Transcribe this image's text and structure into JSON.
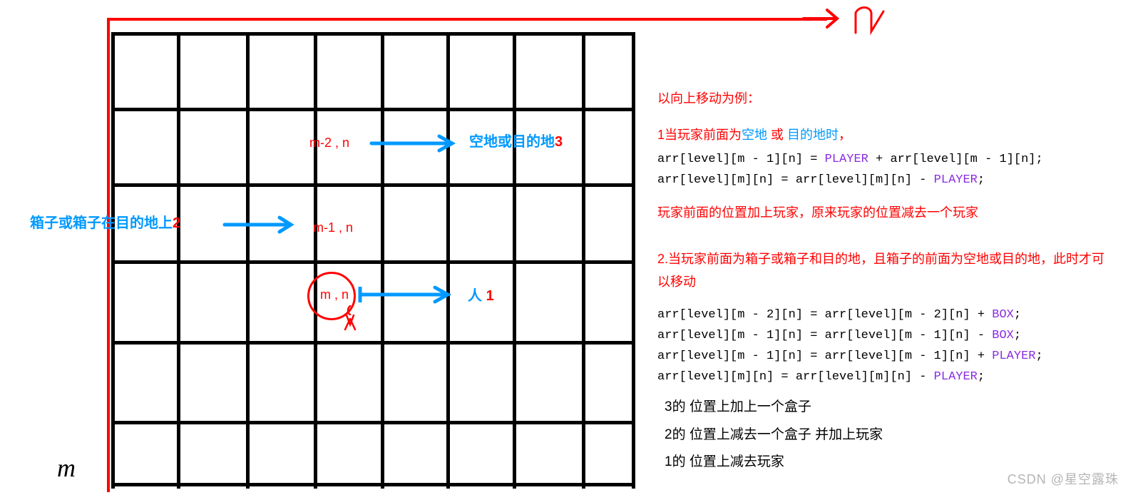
{
  "axes": {
    "top_label": "n",
    "left_label": "m"
  },
  "grid_cells": {
    "cell_m2n": "m-2 , n",
    "cell_m1n": "m-1 , n",
    "cell_mn": "m , n"
  },
  "grid_right_labels": {
    "label3_prefix": "空地或目的地",
    "label3_suffix": "3",
    "label2_prefix": "箱子或箱子在目的地上",
    "label2_suffix": "2",
    "label1_prefix": "人",
    "label1_suffix": "1"
  },
  "panel": {
    "heading": "以向上移动为例：",
    "case1_prefix": "1当玩家前面为",
    "case1_blue1": "空地",
    "case1_mid": " 或 ",
    "case1_blue2": "目的地时",
    "case1_end": "，",
    "code1_a_pre": "arr[level][m - 1][n] = ",
    "code1_a_kw": "PLAYER",
    "code1_a_post": " + arr[level][m - 1][n];",
    "code1_b_pre": "arr[level][m][n] = arr[level][m][n] - ",
    "code1_b_kw": "PLAYER",
    "code1_b_post": ";",
    "case1_expl": "玩家前面的位置加上玩家，原来玩家的位置减去一个玩家",
    "case2": "2.当玩家前面为箱子或箱子和目的地，且箱子的前面为空地或目的地，此时才可以移动",
    "code2_a_pre": "arr[level][m - 2][n] = arr[level][m - 2][n] + ",
    "code2_a_kw": "BOX",
    "code2_a_post": ";",
    "code2_b_pre": "arr[level][m - 1][n] = arr[level][m - 1][n] - ",
    "code2_b_kw": "BOX",
    "code2_b_post": ";",
    "code2_c_pre": "arr[level][m - 1][n] = arr[level][m - 1][n] + ",
    "code2_c_kw": "PLAYER",
    "code2_c_post": ";",
    "code2_d_pre": "arr[level][m][n] = arr[level][m][n] - ",
    "code2_d_kw": "PLAYER",
    "code2_d_post": ";",
    "note3": "3的 位置上加上一个盒子",
    "note2": "2的 位置上减去一个盒子  并加上玩家",
    "note1": "1的 位置上减去玩家"
  },
  "watermark": "CSDN @星空露珠"
}
